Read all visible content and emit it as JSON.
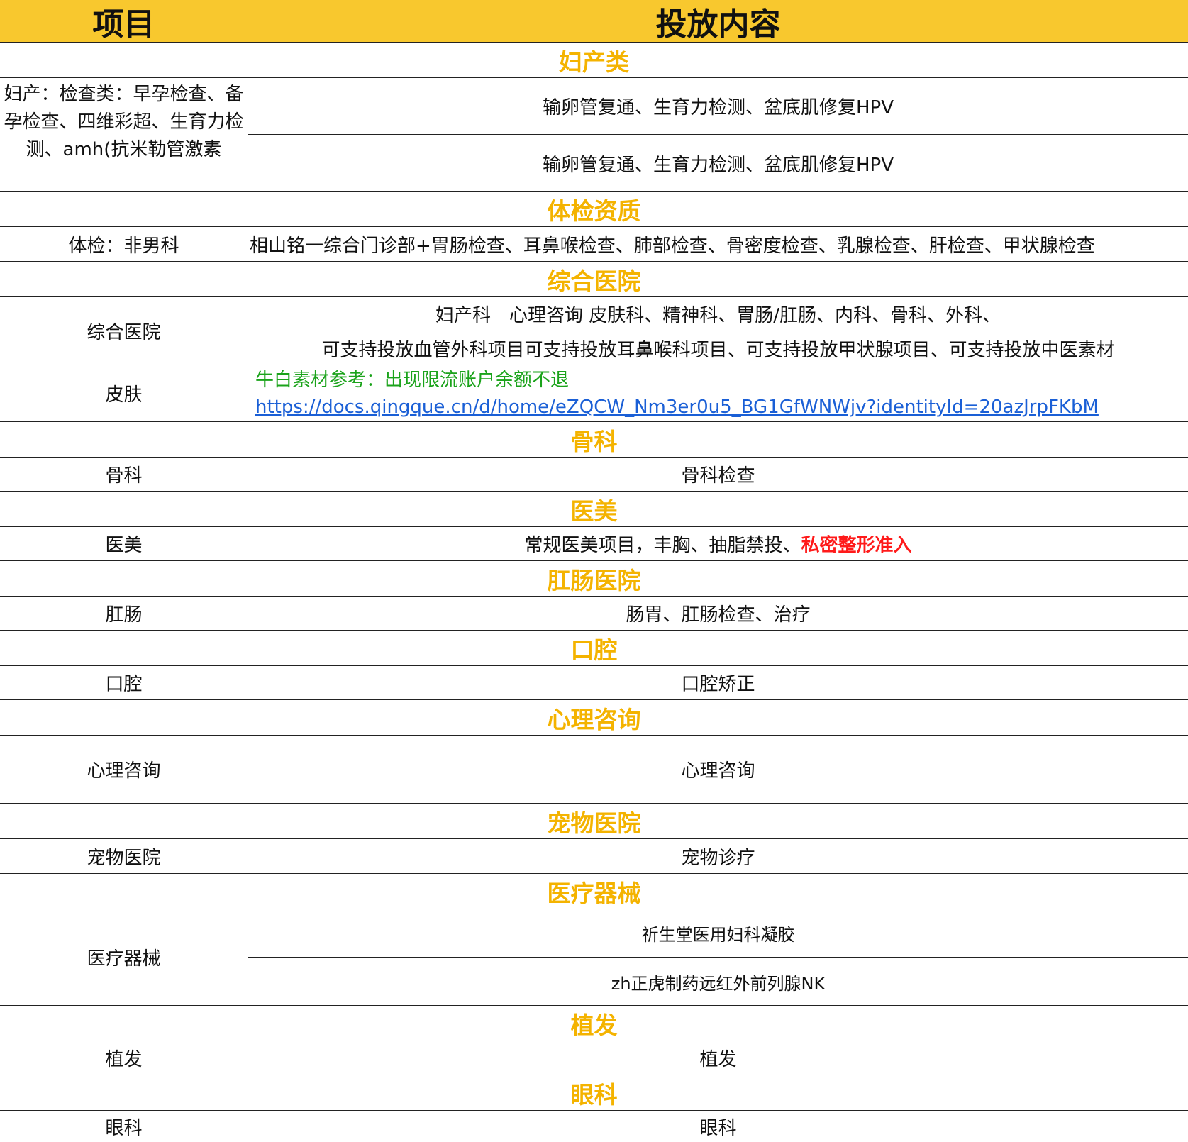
{
  "header": {
    "col1": "项目",
    "col2": "投放内容"
  },
  "sections": {
    "fuchan": "妇产类",
    "tijian": "体检资质",
    "zonghe": "综合医院",
    "guke": "骨科",
    "yimei": "医美",
    "gangchang": "肛肠医院",
    "kouqiang": "口腔",
    "xinli": "心理咨询",
    "chongwu": "宠物医院",
    "qixie": "医疗器械",
    "zhifa": "植发",
    "yanke": "眼科"
  },
  "rows": {
    "fuchan": {
      "label": "妇产：检查类：早孕检查、备孕检查、四维彩超、生育力检测、amh(抗米勒管激素",
      "content1": "输卵管复通、生育力检测、盆底肌修复HPV",
      "content2": "输卵管复通、生育力检测、盆底肌修复HPV"
    },
    "tijian": {
      "label": "体检：非男科",
      "content": "相山铭一综合门诊部+胃肠检查、耳鼻喉检查、肺部检查、骨密度检查、乳腺检查、肝检查、甲状腺检查"
    },
    "zonghe": {
      "label": "综合医院",
      "content1": "妇产科　心理咨询  皮肤科、精神科、胃肠/肛肠、内科、骨科、外科、",
      "content2": "可支持投放血管外科项目可支持投放耳鼻喉科项目、可支持投放甲状腺项目、可支持投放中医素材"
    },
    "pifu": {
      "label": "皮肤",
      "note": "牛白素材参考：出现限流账户余额不退",
      "link": "https://docs.qingque.cn/d/home/eZQCW_Nm3er0u5_BG1GfWNWjv?identityId=20azJrpFKbM"
    },
    "guke": {
      "label": "骨科",
      "content": "骨科检查"
    },
    "yimei": {
      "label": "医美",
      "content": "常规医美项目，丰胸、抽脂禁投、",
      "highlight": "私密整形准入"
    },
    "gangchang": {
      "label": "肛肠",
      "content": "肠胃、肛肠检查、治疗"
    },
    "kouqiang": {
      "label": "口腔",
      "content": "口腔矫正"
    },
    "xinli": {
      "label": "心理咨询",
      "content": "心理咨询"
    },
    "chongwu": {
      "label": "宠物医院",
      "content": "宠物诊疗"
    },
    "qixie": {
      "label": "医疗器械",
      "content1": "祈生堂医用妇科凝胶",
      "content2": "zh正虎制药远红外前列腺NK"
    },
    "zhifa": {
      "label": "植发",
      "content": "植发"
    },
    "yanke": {
      "label": "眼科",
      "content": "眼科"
    }
  },
  "colors": {
    "header_bg": "#f8c82e",
    "section_text": "#f4b300",
    "highlight": "#ff1a1a",
    "note": "#1ba31b",
    "link": "#1a5fd6"
  }
}
